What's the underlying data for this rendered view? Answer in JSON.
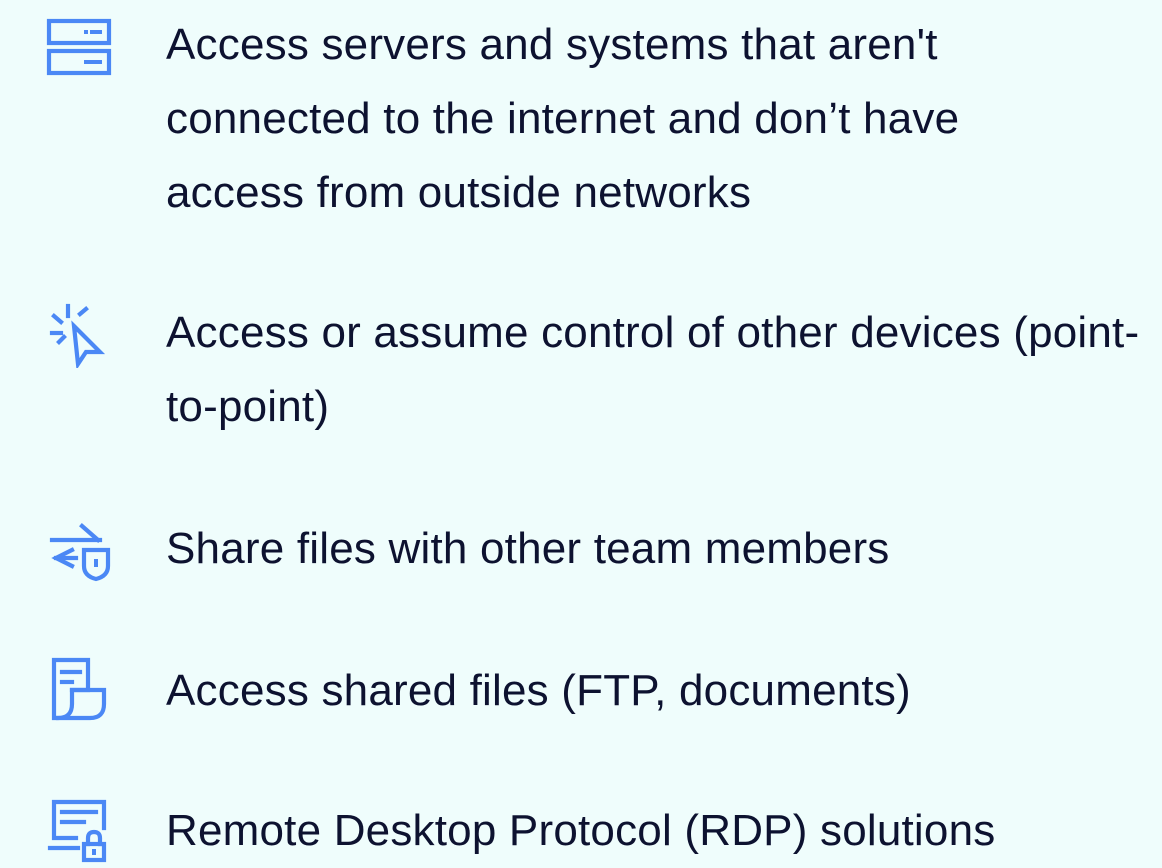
{
  "theme": {
    "background": "#effdfc",
    "text_color": "#0d1230",
    "accent": "#4b88f5"
  },
  "features": [
    {
      "icon": "server-icon",
      "text": "Access servers and systems that aren't connected to the internet and don’t have access from outside networks"
    },
    {
      "icon": "cursor-click-icon",
      "text": "Access or assume control of other devices (point-to-point)"
    },
    {
      "icon": "secure-transfer-icon",
      "text": "Share files with other team members"
    },
    {
      "icon": "shared-document-icon",
      "text": "Access shared files (FTP, documents)"
    },
    {
      "icon": "remote-desktop-lock-icon",
      "text": "Remote Desktop Protocol (RDP) solutions"
    }
  ]
}
